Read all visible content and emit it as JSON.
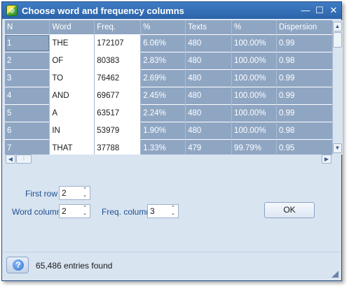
{
  "window": {
    "title": "Choose word and frequency columns"
  },
  "titlebar": {
    "minimize": "—",
    "maximize": "☐",
    "close": "✕"
  },
  "grid": {
    "headers": [
      "N",
      "Word",
      "Freq.",
      "%",
      "Texts",
      "%",
      "Dispersion"
    ],
    "rows": [
      [
        "1",
        "THE",
        "172107",
        "6.06%",
        "480",
        "100.00%",
        "0.99"
      ],
      [
        "2",
        "OF",
        "80383",
        "2.83%",
        "480",
        "100.00%",
        "0.98"
      ],
      [
        "3",
        "TO",
        "76462",
        "2.69%",
        "480",
        "100.00%",
        "0.99"
      ],
      [
        "4",
        "AND",
        "69677",
        "2.45%",
        "480",
        "100.00%",
        "0.99"
      ],
      [
        "5",
        "A",
        "63517",
        "2.24%",
        "480",
        "100.00%",
        "0.99"
      ],
      [
        "6",
        "IN",
        "53979",
        "1.90%",
        "480",
        "100.00%",
        "0.98"
      ],
      [
        "7",
        "THAT",
        "37788",
        "1.33%",
        "479",
        "99.79%",
        "0.95"
      ]
    ]
  },
  "scrollbars": {
    "up": "▲",
    "down": "▼",
    "left": "◀",
    "right": "▶",
    "grip": "⁞"
  },
  "form": {
    "first_row_label": "First row",
    "first_row_value": "2",
    "word_column_label": "Word column",
    "word_column_value": "2",
    "freq_column_label": "Freq. column",
    "freq_column_value": "3",
    "spin_up": "⌃",
    "spin_down": "⌄",
    "ok_label": "OK"
  },
  "status": {
    "help_glyph": "?",
    "text": "65,486 entries found"
  }
}
